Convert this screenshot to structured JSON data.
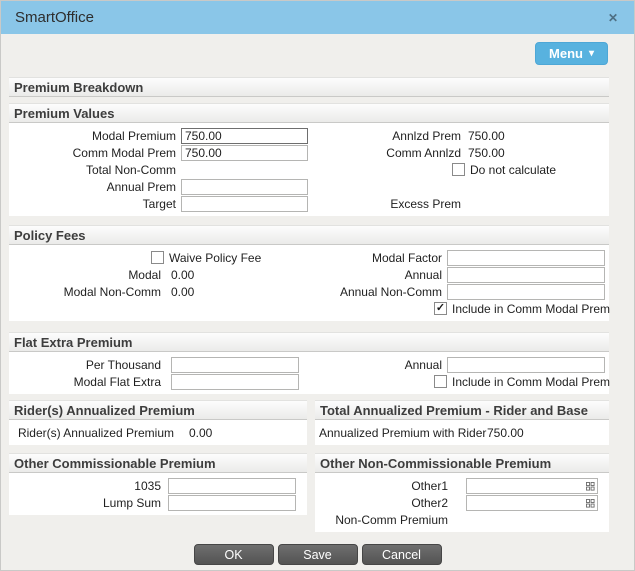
{
  "titlebar": {
    "title": "SmartOffice",
    "close": "✕"
  },
  "menu_button": {
    "label": "Menu",
    "caret": "▾"
  },
  "icons": {
    "close": "close-icon ✕",
    "menu_caret": "chevron-down-icon ▾",
    "checkbox_check": "✓",
    "lookup_grid": "lookup-grid-icon (2x2 squares)"
  },
  "colors": {
    "titlebar": "#8ac6e8",
    "menu_button": "#58b2df",
    "action_button": "#5c5c5c",
    "body_bg": "#f0efec",
    "header_bg": "#ebebe9"
  },
  "premium_breakdown": {
    "title": "Premium Breakdown"
  },
  "premium_values": {
    "title": "Premium Values",
    "modal_premium": {
      "label": "Modal Premium",
      "value": "750.00"
    },
    "comm_modal_prem": {
      "label": "Comm Modal Prem",
      "value": "750.00"
    },
    "total_non_comm": {
      "label": "Total Non-Comm",
      "value": ""
    },
    "annual_prem": {
      "label": "Annual Prem",
      "value": ""
    },
    "target": {
      "label": "Target",
      "value": ""
    },
    "annlzd_prem": {
      "label": "Annlzd Prem",
      "value": "750.00"
    },
    "comm_annlzd": {
      "label": "Comm Annlzd",
      "value": "750.00"
    },
    "do_not_calculate": {
      "label": "Do not calculate",
      "checked": false,
      "glyph": ""
    },
    "excess_prem": {
      "label": "Excess Prem",
      "value": ""
    }
  },
  "policy_fees": {
    "title": "Policy Fees",
    "waive_policy_fee": {
      "label": "Waive Policy Fee",
      "checked": false,
      "glyph": ""
    },
    "modal": {
      "label": "Modal",
      "value": "0.00"
    },
    "modal_non_comm": {
      "label": "Modal Non-Comm",
      "value": "0.00"
    },
    "modal_factor": {
      "label": "Modal Factor",
      "value": ""
    },
    "annual": {
      "label": "Annual",
      "value": ""
    },
    "annual_non_comm": {
      "label": "Annual Non-Comm",
      "value": ""
    },
    "include_in_comm_modal_prem": {
      "label": "Include in Comm Modal Prem",
      "checked": true,
      "glyph": "✓"
    }
  },
  "flat_extra_premium": {
    "title": "Flat Extra Premium",
    "per_thousand": {
      "label": "Per Thousand",
      "value": ""
    },
    "modal_flat_extra": {
      "label": "Modal Flat Extra",
      "value": ""
    },
    "annual": {
      "label": "Annual",
      "value": ""
    },
    "include_in_comm_modal_prem": {
      "label": "Include in Comm Modal Prem",
      "checked": false,
      "glyph": ""
    }
  },
  "riders_annualized_premium": {
    "title": "Rider(s) Annualized Premium",
    "riders_annualized_premium": {
      "label": "Rider(s) Annualized Premium",
      "value": "0.00"
    }
  },
  "total_annualized_premium": {
    "title": "Total Annualized Premium - Rider and Base",
    "annualized_premium_with_rider": {
      "label": "Annualized Premium with Rider",
      "value": "750.00"
    }
  },
  "other_commissionable_premium": {
    "title": "Other Commissionable Premium",
    "field_1035": {
      "label": "1035",
      "value": ""
    },
    "lump_sum": {
      "label": "Lump Sum",
      "value": ""
    }
  },
  "other_non_commissionable_premium": {
    "title": "Other Non-Commissionable Premium",
    "other1": {
      "label": "Other1",
      "value": ""
    },
    "other2": {
      "label": "Other2",
      "value": ""
    },
    "non_comm_premium": {
      "label": "Non-Comm Premium",
      "value": ""
    }
  },
  "action_buttons": {
    "ok": "OK",
    "save": "Save",
    "cancel": "Cancel"
  }
}
